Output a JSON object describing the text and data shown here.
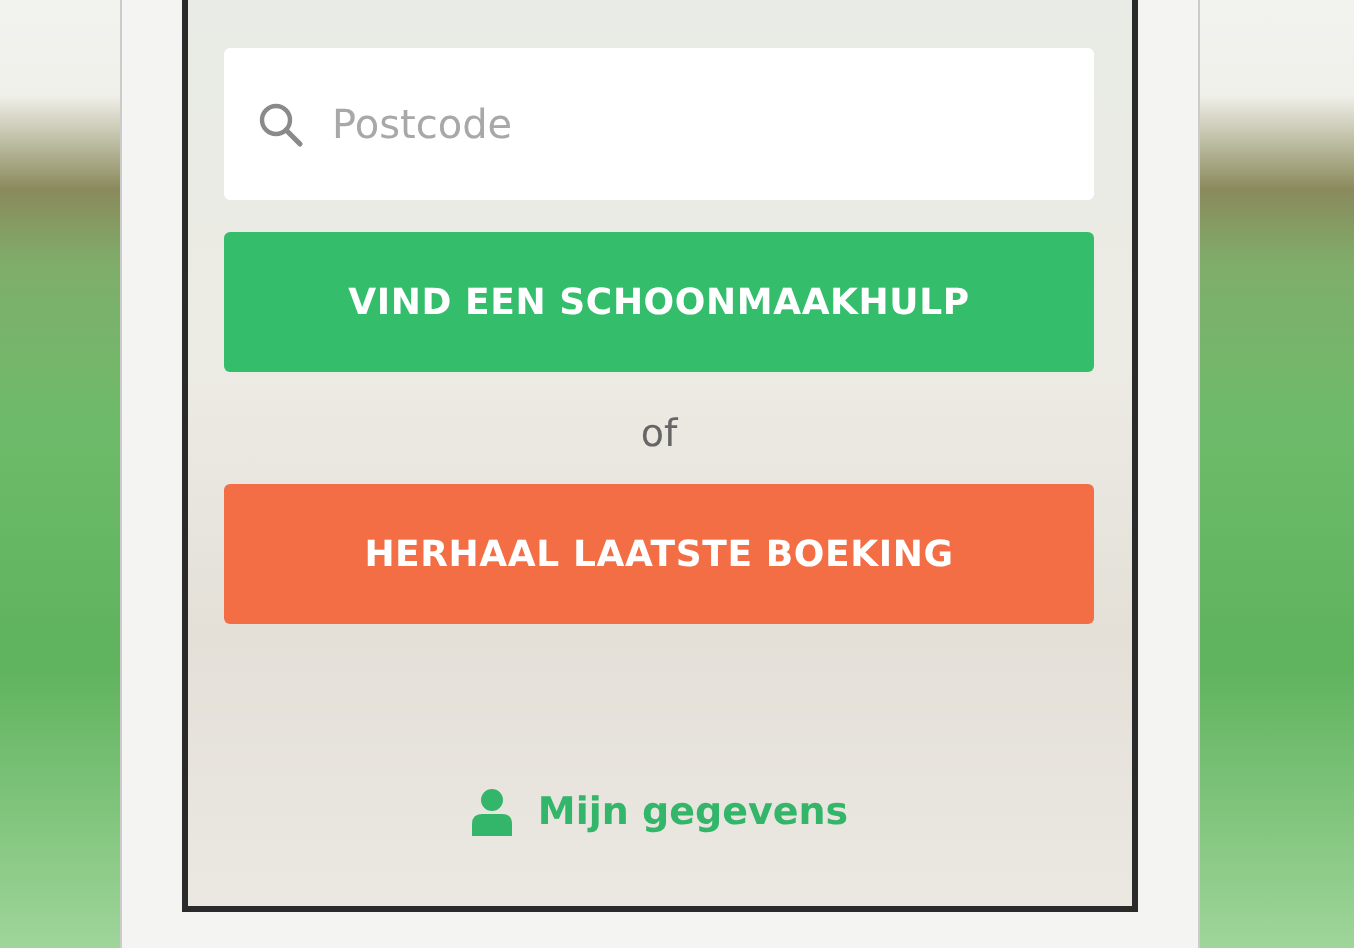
{
  "search": {
    "placeholder": "Postcode"
  },
  "buttons": [
    {
      "label": "VIND EEN SCHOONMAAKHULP",
      "kind": "primary"
    },
    {
      "label": "HERHAAL LAATSTE BOEKING",
      "kind": "secondary"
    }
  ],
  "separator": "of",
  "profile_link": "Mijn gegevens"
}
